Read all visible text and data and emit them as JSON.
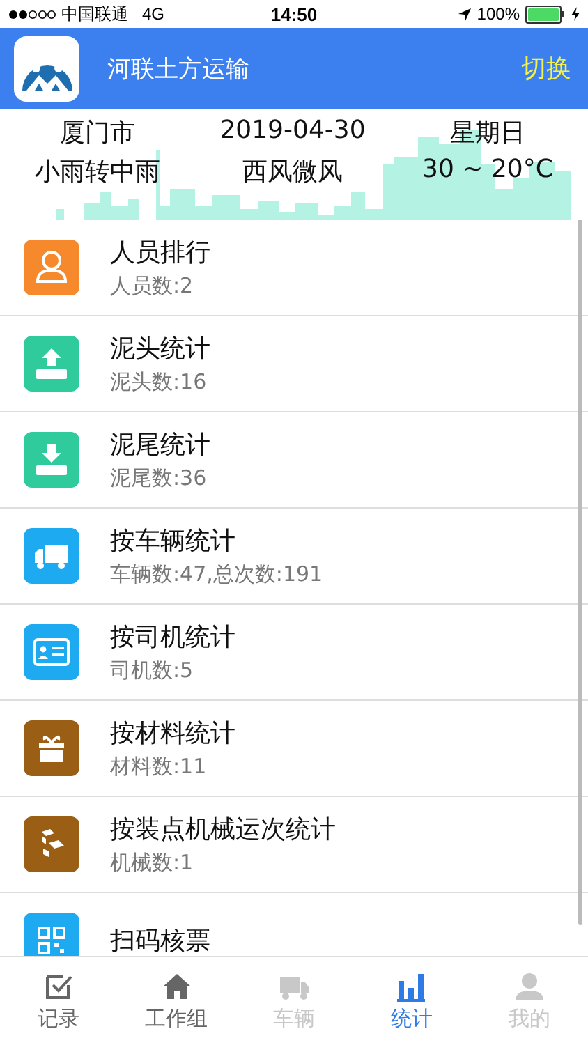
{
  "status_bar": {
    "carrier": "中国联通",
    "network": "4G",
    "time": "14:50",
    "battery": "100%"
  },
  "header": {
    "title": "河联土方运输",
    "action": "切换"
  },
  "weather": {
    "city": "厦门市",
    "date": "2019-04-30",
    "weekday": "星期日",
    "condition": "小雨转中雨",
    "wind": "西风微风",
    "temperature": "30 ~ 20°C"
  },
  "stats": [
    {
      "title": "人员排行",
      "subtitle": "人员数:2",
      "color": "#f6892c"
    },
    {
      "title": "泥头统计",
      "subtitle": "泥头数:16",
      "color": "#2fcb9c"
    },
    {
      "title": "泥尾统计",
      "subtitle": "泥尾数:36",
      "color": "#2fcb9c"
    },
    {
      "title": "按车辆统计",
      "subtitle": "车辆数:47,总次数:191",
      "color": "#1daaf0"
    },
    {
      "title": "按司机统计",
      "subtitle": "司机数:5",
      "color": "#1daaf0"
    },
    {
      "title": "按材料统计",
      "subtitle": "材料数:11",
      "color": "#9a5e14"
    },
    {
      "title": "按装点机械运次统计",
      "subtitle": "机械数:1",
      "color": "#9a5e14"
    },
    {
      "title": "扫码核票",
      "color": "#1daaf0"
    }
  ],
  "tab_bar": [
    {
      "label": "记录",
      "selected": false,
      "disabled": false
    },
    {
      "label": "工作组",
      "selected": false,
      "disabled": false
    },
    {
      "label": "车辆",
      "selected": false,
      "disabled": true
    },
    {
      "label": "统计",
      "selected": true,
      "disabled": false
    },
    {
      "label": "我的",
      "selected": false,
      "disabled": true
    }
  ]
}
